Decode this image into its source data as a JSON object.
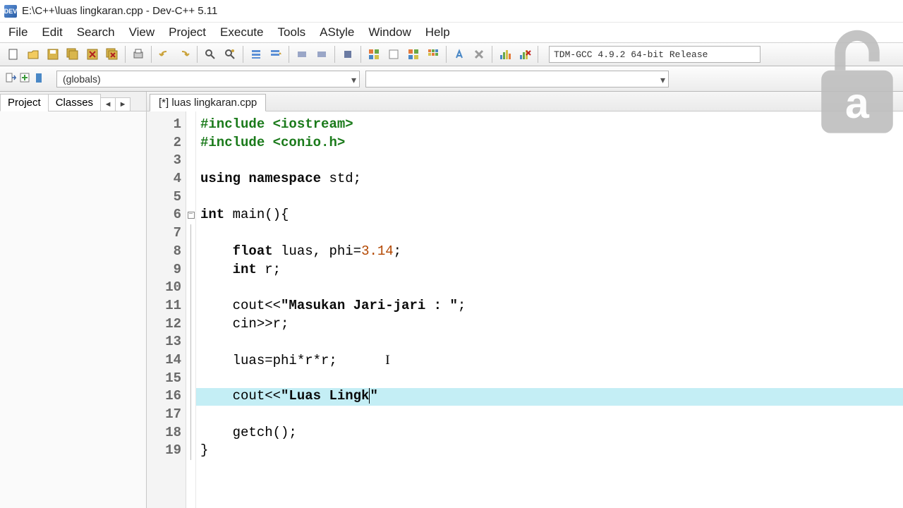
{
  "window": {
    "title": "E:\\C++\\luas lingkaran.cpp - Dev-C++ 5.11"
  },
  "menu": {
    "file": "File",
    "edit": "Edit",
    "search": "Search",
    "view": "View",
    "project": "Project",
    "execute": "Execute",
    "tools": "Tools",
    "astyle": "AStyle",
    "window": "Window",
    "help": "Help"
  },
  "compiler": {
    "selected": "TDM-GCC 4.9.2 64-bit Release"
  },
  "scope": {
    "selected": "(globals)"
  },
  "sidebar": {
    "tabs": {
      "project": "Project",
      "classes": "Classes"
    }
  },
  "tab": {
    "label": "[*] luas lingkaran.cpp"
  },
  "code": {
    "l1a": "#include ",
    "l1b": "<iostream>",
    "l2a": "#include ",
    "l2b": "<conio.h>",
    "l4a": "using ",
    "l4b": "namespace ",
    "l4c": "std",
    "l6a": "int ",
    "l6b": "main",
    "l8a": "float ",
    "l8b": "luas, phi=",
    "l8n": "3.14",
    "l9a": "int ",
    "l9b": "r;",
    "l11a": "cout<<",
    "l11s": "\"Masukan Jari-jari : \"",
    "l12": "cin>>r;",
    "l14": "luas=phi*r*r;",
    "l16a": "cout<<",
    "l16s": "\"Luas Lingk",
    "l16e": "\"",
    "l18": "getch();"
  },
  "lineNumbers": [
    "1",
    "2",
    "3",
    "4",
    "5",
    "6",
    "7",
    "8",
    "9",
    "10",
    "11",
    "12",
    "13",
    "14",
    "15",
    "16",
    "17",
    "18",
    "19"
  ]
}
